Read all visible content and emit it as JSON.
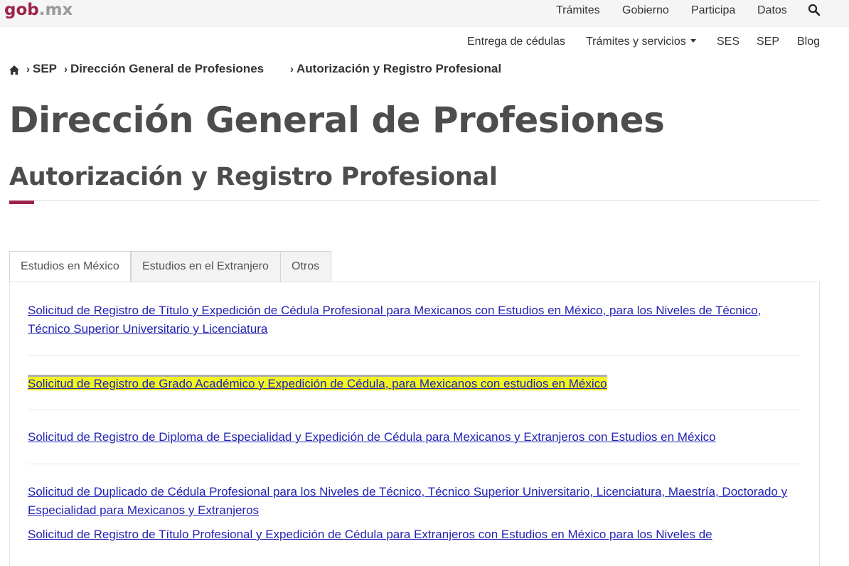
{
  "logo": {
    "brand": "gob",
    "suffix": ".mx"
  },
  "top_nav": [
    "Trámites",
    "Gobierno",
    "Participa",
    "Datos"
  ],
  "sub_nav": {
    "items": [
      "Entrega de cédulas",
      "Trámites y servicios",
      "SES",
      "SEP",
      "Blog"
    ]
  },
  "breadcrumb": [
    "SEP",
    "Dirección General de Profesiones",
    "Autorización y Registro Profesional"
  ],
  "page": {
    "title": "Dirección General de Profesiones",
    "subtitle": "Autorización y Registro Profesional"
  },
  "tabs": [
    "Estudios en México",
    "Estudios en el Extranjero",
    "Otros"
  ],
  "active_tab": "Estudios en México",
  "links": [
    "Solicitud de Registro de Título y Expedición de Cédula Profesional para Mexicanos con Estudios en México, para los Niveles de Técnico, Técnico Superior Universitario y Licenciatura",
    "Solicitud de Registro de Grado Académico y Expedición de Cédula, para Mexicanos con estudios en México",
    "Solicitud de Registro de Diploma de Especialidad y Expedición de Cédula para Mexicanos y Extranjeros con Estudios en México",
    "Solicitud de Duplicado de Cédula Profesional para los Niveles de Técnico, Técnico Superior Universitario, Licenciatura, Maestría, Doctorado y Especialidad para Mexicanos y Extranjeros",
    "Solicitud de Registro de Título Profesional y Expedición de Cédula para Extranjeros con Estudios en México para los Niveles de"
  ],
  "colors": {
    "brand": "#9d2449",
    "link": "#2323b3",
    "highlight": "#f2f520"
  }
}
